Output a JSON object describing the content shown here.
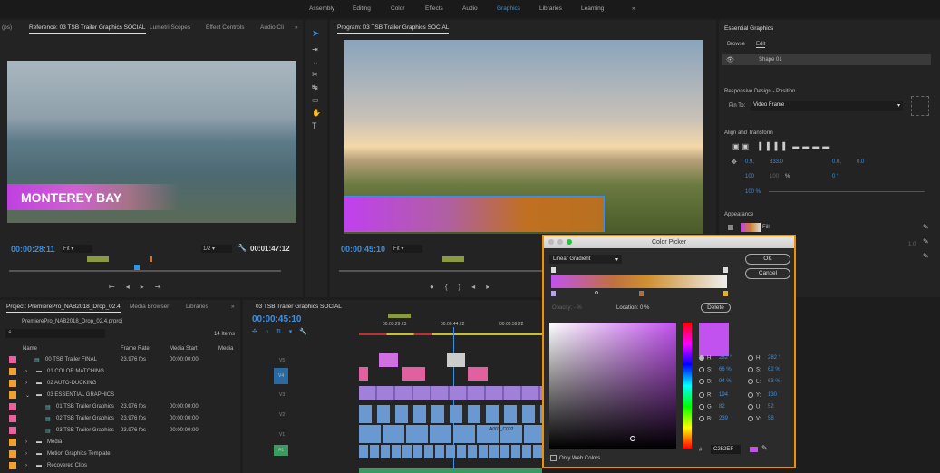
{
  "workspaces": {
    "items": [
      "Assembly",
      "Editing",
      "Color",
      "Effects",
      "Audio",
      "Graphics",
      "Libraries",
      "Learning"
    ],
    "active": "Graphics",
    "more": "»"
  },
  "source": {
    "tabs": [
      "(ps)",
      "Reference: 03 TSB Trailer Graphics SOCIAL",
      "Lumetri Scopes",
      "Effect Controls",
      "Audio Cli"
    ],
    "more": "»",
    "title_text": "MONTEREY BAY",
    "timecode": "00:00:28:11",
    "fit": "Fit",
    "resolution": "1/2",
    "duration": "00:01:47:12"
  },
  "program": {
    "tab": "Program: 03 TSB Trailer Graphics SOCIAL",
    "timecode": "00:00:45:10",
    "fit": "Fit"
  },
  "essential": {
    "title": "Essential Graphics",
    "tabs": [
      "Browse",
      "Edit"
    ],
    "layer": "Shape 01",
    "responsive": "Responsive Design - Position",
    "pin_label": "Pin To:",
    "pin_value": "Video Frame",
    "align": "Align and Transform",
    "pos_x": "0.9,",
    "pos_y": "833.0",
    "anchor_x": "0.0,",
    "anchor_y": "0.0",
    "scale": "100",
    "scale_h": "100",
    "pct": "%",
    "rotation": "0 °",
    "opacity": "100 %",
    "appearance": "Appearance",
    "fill": "Fill",
    "stroke_val": "1.0"
  },
  "project": {
    "tabs": [
      "Project: PremierePro_NAB2018_Drop_02.4",
      "Media Browser",
      "Libraries"
    ],
    "more": "»",
    "file": "PremierePro_NAB2018_Drop_02.4.prproj",
    "count": "14 Items",
    "cols": [
      "Name",
      "Frame Rate",
      "Media Start",
      "Media"
    ],
    "rows": [
      {
        "name": "00 TSB Trailer FINAL",
        "rate": "23.976 fps",
        "start": "00:00:00:00",
        "color": "#e8609c",
        "type": "seq",
        "indent": 1
      },
      {
        "name": "01 COLOR MATCHING",
        "rate": "",
        "start": "",
        "color": "#f0a030",
        "type": "bin",
        "indent": 1
      },
      {
        "name": "02 AUTO-DUCKING",
        "rate": "",
        "start": "",
        "color": "#f0a030",
        "type": "bin",
        "indent": 1
      },
      {
        "name": "03 ESSENTIAL GRAPHICS",
        "rate": "",
        "start": "",
        "color": "#f0a030",
        "type": "bin-open",
        "indent": 1
      },
      {
        "name": "01 TSB Trailer Graphics",
        "rate": "23.976 fps",
        "start": "00:00:00:00",
        "color": "#e8609c",
        "type": "seq",
        "indent": 2
      },
      {
        "name": "02 TSB Trailer Graphics",
        "rate": "23.976 fps",
        "start": "00:00:00:00",
        "color": "#e8609c",
        "type": "seq",
        "indent": 2
      },
      {
        "name": "03 TSB Trailer Graphics",
        "rate": "23.976 fps",
        "start": "00:00:00:00",
        "color": "#e8609c",
        "type": "seq",
        "indent": 2
      },
      {
        "name": "Media",
        "rate": "",
        "start": "",
        "color": "#f0a030",
        "type": "bin",
        "indent": 1
      },
      {
        "name": "Motion Graphics Template",
        "rate": "",
        "start": "",
        "color": "#f0a030",
        "type": "bin",
        "indent": 1
      },
      {
        "name": "Recovered Clips",
        "rate": "",
        "start": "",
        "color": "#f0a030",
        "type": "bin",
        "indent": 1
      }
    ]
  },
  "timeline": {
    "tab": "03 TSB Trailer Graphics SOCIAL",
    "timecode": "00:00:45:10",
    "ticks": [
      "00:00:29:23",
      "00:00:44:22",
      "00:00:59:22"
    ],
    "tracks": [
      "V5",
      "V4",
      "V3",
      "V2",
      "V1",
      "A1"
    ],
    "clip_label": "A003_C002"
  },
  "picker": {
    "title": "Color Picker",
    "mode": "Linear Gradient",
    "ok": "OK",
    "cancel": "Cancel",
    "opacity": "Opacity: - %",
    "location_label": "Location:",
    "location": "0 %",
    "delete": "Delete",
    "hsb": [
      {
        "k": "H:",
        "v": "282 °"
      },
      {
        "k": "S:",
        "v": "66 %"
      },
      {
        "k": "B:",
        "v": "94 %"
      }
    ],
    "hsl": [
      {
        "k": "H:",
        "v": "282 °"
      },
      {
        "k": "S:",
        "v": "62 %"
      },
      {
        "k": "L:",
        "v": "63 %"
      }
    ],
    "rgb": [
      {
        "k": "R:",
        "v": "194"
      },
      {
        "k": "G:",
        "v": "82"
      },
      {
        "k": "B:",
        "v": "239"
      }
    ],
    "yuv": [
      {
        "k": "Y:",
        "v": "130"
      },
      {
        "k": "U:",
        "v": "52"
      },
      {
        "k": "V:",
        "v": "58"
      }
    ],
    "hash": "#",
    "hex": "C252EF",
    "web_only": "Only Web Colors",
    "color": "#c252ef"
  }
}
